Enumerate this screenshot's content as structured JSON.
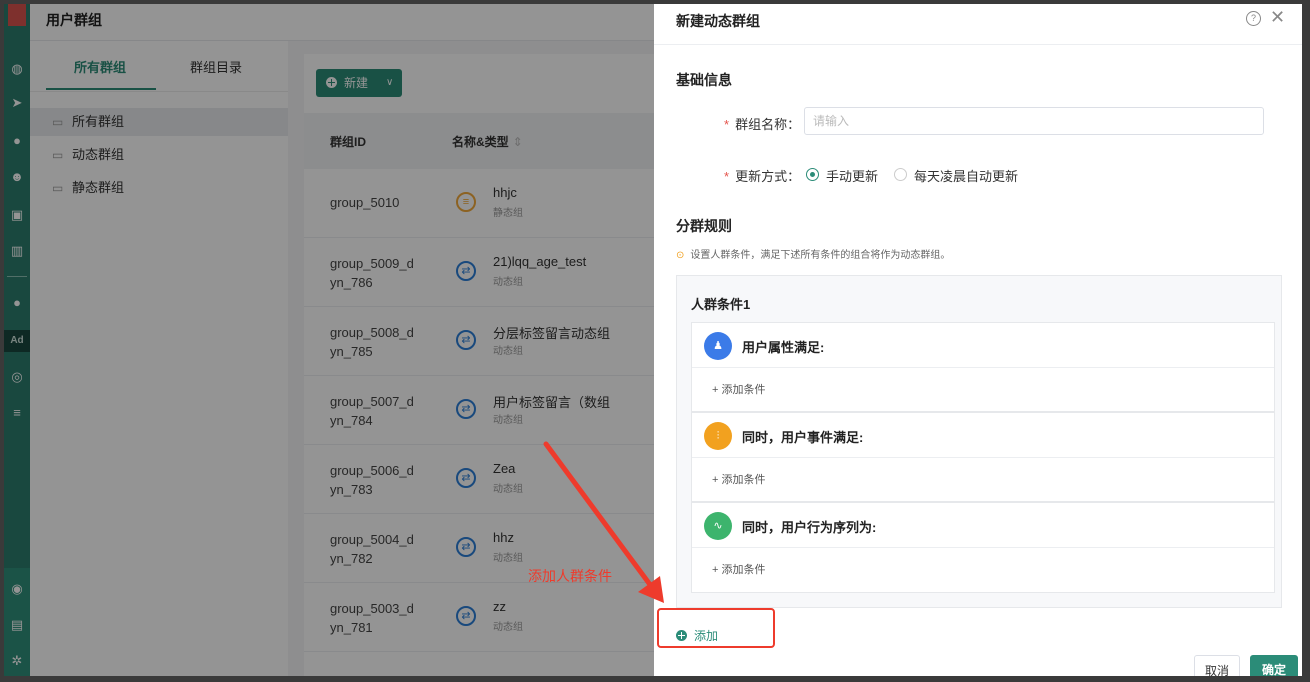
{
  "page": {
    "title": "用户群组"
  },
  "rail": {
    "icons": [
      "dashboard-icon",
      "send-icon",
      "user-icon",
      "users-icon",
      "report-icon",
      "chart-icon",
      "wechat-icon",
      "ad-icon",
      "target-icon",
      "list-icon",
      "scan-icon",
      "storage-icon",
      "settings-icon"
    ]
  },
  "tree": {
    "tabs": [
      {
        "label": "所有群组",
        "active": true
      },
      {
        "label": "群组目录",
        "active": false
      }
    ],
    "items": [
      {
        "label": "所有群组",
        "selected": true
      },
      {
        "label": "动态群组"
      },
      {
        "label": "静态群组"
      }
    ]
  },
  "list": {
    "new_button": "新建",
    "columns": {
      "id": "群组ID",
      "name": "名称&类型"
    },
    "rows": [
      {
        "id": "group_5010",
        "name": "hhjc",
        "type": "静态组"
      },
      {
        "id": "group_5009_d yn_786",
        "name": "21)lqq_age_test",
        "type": "动态组"
      },
      {
        "id": "group_5008_d yn_785",
        "name": "分层标签留言动态组",
        "type": "动态组"
      },
      {
        "id": "group_5007_d yn_784",
        "name": "用户标签留言（数组",
        "type": "动态组"
      },
      {
        "id": "group_5006_d yn_783",
        "name": "Zea",
        "type": "动态组"
      },
      {
        "id": "group_5004_d yn_782",
        "name": "hhz",
        "type": "动态组"
      },
      {
        "id": "group_5003_d yn_781",
        "name": "zz",
        "type": "动态组"
      }
    ]
  },
  "drawer": {
    "title": "新建动态群组",
    "basic_section": "基础信息",
    "name_label": "群组名称：",
    "name_placeholder": "请输入",
    "update_label": "更新方式：",
    "update_options": [
      {
        "label": "手动更新",
        "selected": true
      },
      {
        "label": "每天凌晨自动更新",
        "selected": false
      }
    ],
    "rules_section": "分群规则",
    "rules_hint": "设置人群条件，满足下述所有条件的组合将作为动态群组。",
    "condition_group": {
      "title": "人群条件1",
      "cards": [
        {
          "title": "用户属性满足:",
          "icon": "user-attr-icon",
          "color": "#3b7be8",
          "add": "添加条件"
        },
        {
          "title": "同时，用户事件满足:",
          "icon": "event-icon",
          "color": "#f2a11f",
          "add": "添加条件"
        },
        {
          "title": "同时，用户行为序列为:",
          "icon": "sequence-icon",
          "color": "#3db46d",
          "add": "添加条件"
        }
      ]
    },
    "add_link": "添加",
    "cancel_button": "取消",
    "ok_button": "确定"
  },
  "annotation": {
    "text": "添加人群条件",
    "color": "#ee3b2c"
  }
}
